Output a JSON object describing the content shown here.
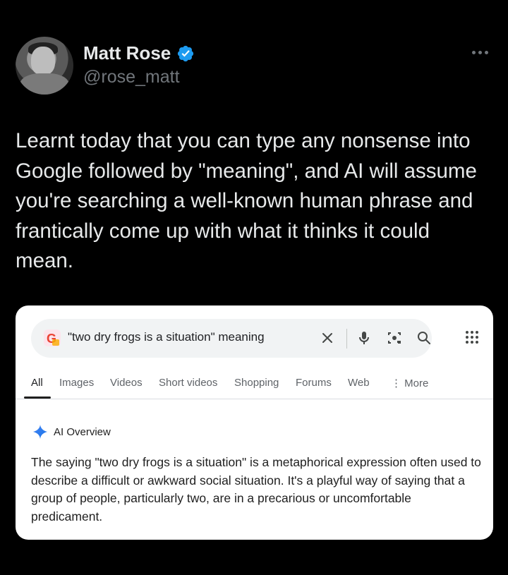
{
  "post": {
    "author_name": "Matt Rose",
    "author_handle": "@rose_matt",
    "text": "Learnt today that you can type any nonsense into Google followed by \"meaning\", and AI will assume you're searching a well-known human phrase and frantically come up with what it thinks it could mean."
  },
  "google": {
    "query": "\"two dry frogs is a situation\" meaning",
    "tabs": [
      "All",
      "Images",
      "Videos",
      "Short videos",
      "Shopping",
      "Forums",
      "Web",
      "More"
    ],
    "active_tab": "All",
    "ai_overview_title": "AI Overview",
    "ai_overview_text": "The saying \"two dry frogs is a situation\" is a metaphorical expression often used to describe a difficult or awkward social situation. It's a playful way of saying that a group of people, particularly two, are in a precarious or uncomfortable predicament."
  },
  "colors": {
    "background": "#000000",
    "verified_blue": "#1d9bf0",
    "muted_text": "#71767b",
    "card_bg": "#ffffff"
  },
  "icons": [
    "more-icon",
    "verified-icon",
    "google-lens-logo",
    "clear-icon",
    "mic-icon",
    "camera-search-icon",
    "search-icon",
    "apps-grid-icon",
    "ai-sparkle-icon"
  ]
}
